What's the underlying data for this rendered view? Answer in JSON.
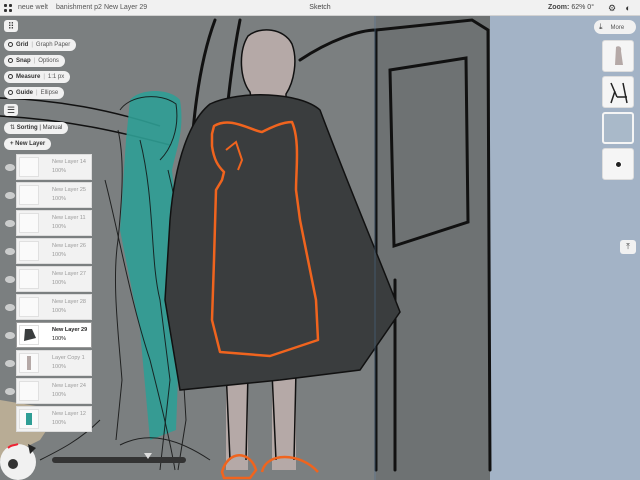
{
  "topbar": {
    "breadcrumbs": [
      "neue welt",
      "banishment p2",
      "New Layer 29"
    ],
    "app_title": "Sketch",
    "zoom_label": "Zoom:",
    "zoom_value": "62%",
    "rotation_value": "0°"
  },
  "tools": {
    "grid": {
      "label": "Grid",
      "value": "Graph Paper"
    },
    "snap": {
      "label": "Snap",
      "value": "Options"
    },
    "measure": {
      "label": "Measure",
      "value": "1:1 px"
    },
    "guide": {
      "label": "Guide",
      "value": "Ellipse"
    }
  },
  "layers_panel": {
    "sorting_label": "Sorting",
    "sorting_value": "Manual",
    "new_layer_label": "+ New Layer",
    "layers": [
      {
        "name": "New Layer 14",
        "opacity": "100%",
        "selected": false
      },
      {
        "name": "New Layer 25",
        "opacity": "100%",
        "selected": false
      },
      {
        "name": "New Layer 11",
        "opacity": "100%",
        "selected": false
      },
      {
        "name": "New Layer 26",
        "opacity": "100%",
        "selected": false
      },
      {
        "name": "New Layer 27",
        "opacity": "100%",
        "selected": false
      },
      {
        "name": "New Layer 28",
        "opacity": "100%",
        "selected": false
      },
      {
        "name": "New Layer 29",
        "opacity": "100%",
        "selected": true
      },
      {
        "name": "Layer Copy 1",
        "opacity": "100%",
        "selected": false
      },
      {
        "name": "New Layer 24",
        "opacity": "100%",
        "selected": false
      },
      {
        "name": "New Layer 12",
        "opacity": "100%",
        "selected": false
      }
    ]
  },
  "right_sidebar": {
    "more_label": "More"
  },
  "colors": {
    "canvas_bg": "#7b7f80",
    "wall_right": "#a3b3c6",
    "cloak": "#3a3d3e",
    "dress_outline": "#f0641e",
    "skin": "#b5a9a7",
    "teal_figure": "#2f9e95"
  }
}
